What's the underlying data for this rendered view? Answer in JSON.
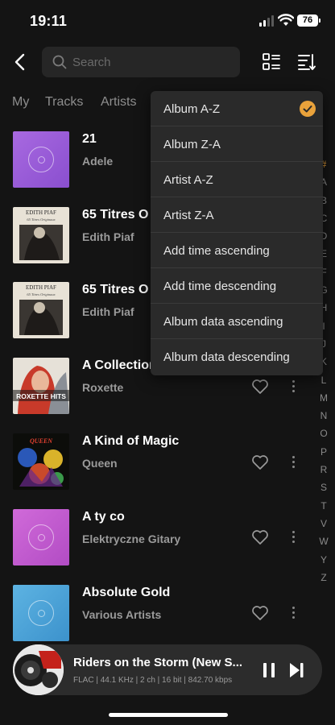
{
  "status_bar": {
    "time": "19:11",
    "battery": "76"
  },
  "search": {
    "placeholder": "Search"
  },
  "tabs": [
    "My",
    "Tracks",
    "Artists"
  ],
  "albums": [
    {
      "title": "21",
      "artist": "Adele",
      "art": "placeholder",
      "color": "#9b5fd6"
    },
    {
      "title": "65 Titres O",
      "artist": "Edith Piaf",
      "art": "edith-piaf-cover"
    },
    {
      "title": "65 Titres O",
      "artist": "Edith Piaf",
      "art": "edith-piaf-cover"
    },
    {
      "title": "A Collection",
      "artist": "Roxette",
      "art": "roxette-hits-cover"
    },
    {
      "title": "A Kind of Magic",
      "artist": "Queen",
      "art": "queen-kind-of-magic-cover"
    },
    {
      "title": "A ty co",
      "artist": "Elektryczne Gitary",
      "art": "placeholder",
      "color": "#c35bd0"
    },
    {
      "title": "Absolute Gold",
      "artist": "Various Artists",
      "art": "placeholder",
      "color": "#4aa3d6"
    }
  ],
  "cover_text": {
    "edith_title": "EDITH PIAF",
    "edith_sub": "65 Titres Originaux",
    "roxette_text": "ROXETTE HITS",
    "queen_text": "QUEEN"
  },
  "alphabet": [
    "#",
    "A",
    "B",
    "C",
    "D",
    "E",
    "F",
    "G",
    "H",
    "I",
    "J",
    "K",
    "L",
    "M",
    "N",
    "O",
    "P",
    "R",
    "S",
    "T",
    "V",
    "W",
    "Y",
    "Z"
  ],
  "sort_menu": {
    "options": [
      "Album A-Z",
      "Album Z-A",
      "Artist A-Z",
      "Artist Z-A",
      "Add time ascending",
      "Add time descending",
      "Album data ascending",
      "Album data descending"
    ],
    "selected": "Album A-Z",
    "accent": "#e9a23b"
  },
  "now_playing": {
    "title": "Riders on the Storm (New S...",
    "info": "FLAC | 44.1 KHz | 2 ch | 16 bit | 842.70 kbps"
  }
}
